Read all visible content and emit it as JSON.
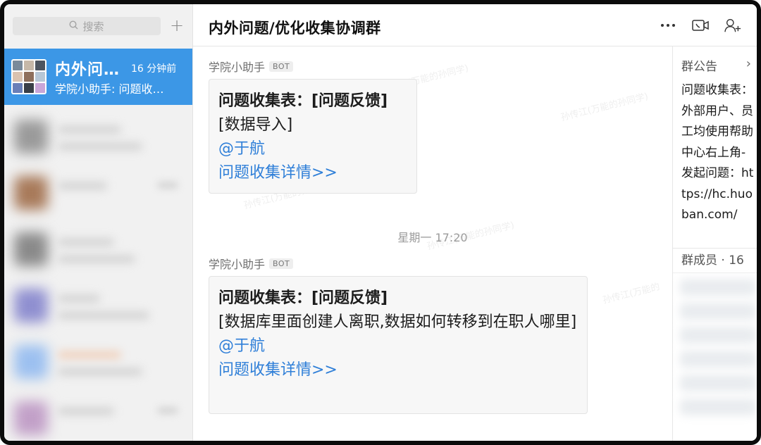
{
  "sidebar": {
    "search_placeholder": "搜索",
    "add_label": "+",
    "active_conversation": {
      "title": "内外问…",
      "time": "16 分钟前",
      "preview": "学院小助手: 问题收…"
    }
  },
  "chat": {
    "title": "内外问题/优化收集协调群",
    "header_icons": [
      "more-icon",
      "video-call-icon",
      "add-member-icon"
    ],
    "messages": [
      {
        "sender": "学院小助手",
        "badge": "BOT",
        "heading": "问题收集表：[问题反馈]",
        "body": "[数据导入]",
        "mention": "@于航",
        "link": "问题收集详情>>"
      },
      {
        "sender": "学院小助手",
        "badge": "BOT",
        "heading": "问题收集表：[问题反馈]",
        "body": "[数据库里面创建人离职,数据如何转移到在职人哪里]",
        "mention": "@于航",
        "link": "问题收集详情>>"
      }
    ],
    "time_divider": "星期一 17:20"
  },
  "right_panel": {
    "notice_title": "群公告",
    "notice_chevron": "›",
    "notice_text": "问题收集表：外部用户、员工均使用帮助中心右上角-发起问题：https://hc.huoban.com/",
    "members_label": "群成员 · 16"
  },
  "colors": {
    "accent": "#3c97e6",
    "link": "#2f7fd8",
    "bubble": "#f7f7f7"
  }
}
